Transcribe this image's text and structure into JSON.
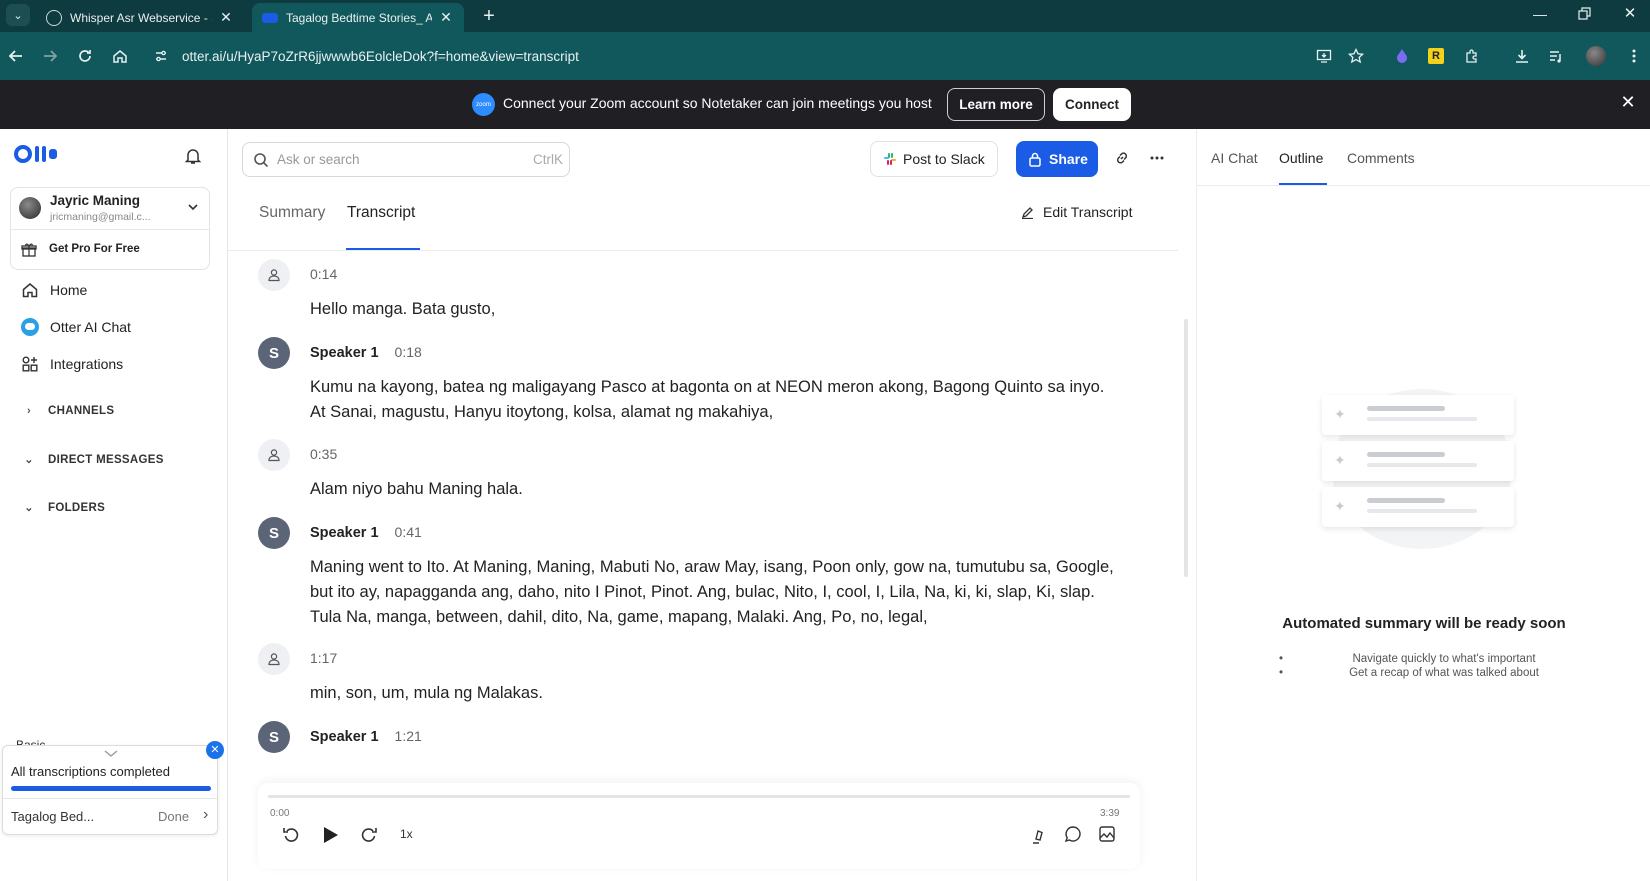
{
  "browser": {
    "tabs": [
      {
        "title": "Whisper Asr Webservice - Swag"
      },
      {
        "title": "Tagalog Bedtime Stories_ Alam"
      }
    ],
    "new_tab_symbol": "+",
    "url": "otter.ai/u/HyaP7oZrR6jjwwwb6EolcleDok?f=home&view=transcript"
  },
  "banner": {
    "zoom_badge": "zoom",
    "text": "Connect your Zoom account so Notetaker can join meetings you host",
    "learn_more": "Learn more",
    "connect": "Connect"
  },
  "sidebar": {
    "user_name": "Jayric Maning",
    "user_email": "jricmaning@gmail.c...",
    "pro_label": "Get Pro For Free",
    "nav": [
      {
        "label": "Home",
        "icon": "home-icon"
      },
      {
        "label": "Otter AI Chat",
        "icon": "otter-chat-icon"
      },
      {
        "label": "Integrations",
        "icon": "integrations-icon"
      }
    ],
    "sections": [
      "CHANNELS",
      "DIRECT MESSAGES",
      "FOLDERS"
    ],
    "basic_label": "Basic",
    "status_title": "All transcriptions completed",
    "status_item": "Tagalog Bed...",
    "status_done": "Done"
  },
  "toolbar": {
    "search_placeholder": "Ask or search",
    "search_shortcut": "CtrlK",
    "slack_button": "Post to Slack",
    "share_button": "Share"
  },
  "tabs": {
    "summary": "Summary",
    "transcript": "Transcript",
    "edit": "Edit Transcript"
  },
  "transcript": [
    {
      "speaker": "",
      "time": "0:14",
      "text": "Hello manga. Bata gusto,"
    },
    {
      "speaker": "Speaker 1",
      "initial": "S",
      "time": "0:18",
      "text": "Kumu na kayong, batea ng maligayang Pasco at bagonta on at NEON meron akong, Bagong Quinto sa inyo. At Sanai, magustu, Hanyu itoytong, kolsa, alamat ng makahiya,"
    },
    {
      "speaker": "",
      "time": "0:35",
      "text": "Alam niyo bahu Maning hala."
    },
    {
      "speaker": "Speaker 1",
      "initial": "S",
      "time": "0:41",
      "text": "Maning went to Ito. At Maning, Maning, Mabuti No, araw May, isang, Poon only, gow na, tumutubu sa, Google, but ito ay, napagganda ang, daho, nito I Pinot, Pinot. Ang, bulac, Nito, I, cool, I, Lila, Na, ki, ki, slap, Ki, slap. Tula Na, manga, between, dahil, dito, Na, game, mapang, Malaki. Ang, Po, no, legal,"
    },
    {
      "speaker": "",
      "time": "1:17",
      "text": "min, son, um, mula ng Malakas."
    },
    {
      "speaker": "Speaker 1",
      "initial": "S",
      "time": "1:21",
      "text": ""
    }
  ],
  "player": {
    "start_time": "0:00",
    "end_time": "3:39",
    "speed": "1x",
    "progress": 0.0
  },
  "right_panel": {
    "tabs": [
      "AI Chat",
      "Outline",
      "Comments"
    ],
    "active_tab": "Outline",
    "empty_title": "Automated summary will be ready soon",
    "bullets": [
      "Navigate quickly to what's important",
      "Get a recap of what was talked about"
    ]
  },
  "colors": {
    "browser_tabbar": "#0d3b3f",
    "browser_toolbar": "#11585d",
    "banner": "#1f1f24",
    "accent": "#1a5ce6",
    "status_close": "#1a73e8"
  }
}
